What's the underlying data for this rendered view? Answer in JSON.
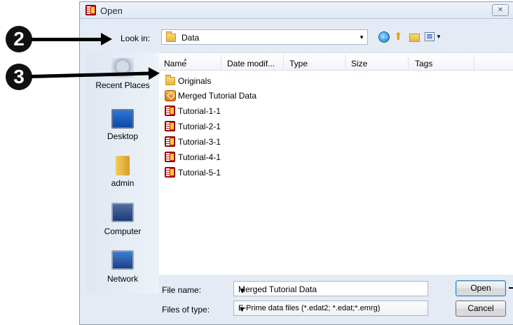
{
  "dialog": {
    "title": "Open",
    "close_label": "✕"
  },
  "toolbar": {
    "look_in_label": "Look in:",
    "look_in_value": "Data",
    "icons": [
      "back-icon",
      "up-folder-icon",
      "new-folder-icon",
      "views-icon",
      "views-menu-icon"
    ]
  },
  "places": [
    {
      "label": "Recent Places",
      "icon": "recent-places-icon"
    },
    {
      "label": "Desktop",
      "icon": "desktop-icon"
    },
    {
      "label": "admin",
      "icon": "user-folder-icon"
    },
    {
      "label": "Computer",
      "icon": "computer-icon"
    },
    {
      "label": "Network",
      "icon": "network-icon"
    }
  ],
  "columns": [
    "Name",
    "Date modif...",
    "Type",
    "Size",
    "Tags"
  ],
  "files": [
    {
      "name": "Originals",
      "icon": "folder-icon"
    },
    {
      "name": "Merged Tutorial Data",
      "icon": "merged-data-file-icon"
    },
    {
      "name": "Tutorial-1-1",
      "icon": "eprime-data-file-icon"
    },
    {
      "name": "Tutorial-2-1",
      "icon": "eprime-data-file-icon"
    },
    {
      "name": "Tutorial-3-1",
      "icon": "eprime-data-file-icon"
    },
    {
      "name": "Tutorial-4-1",
      "icon": "eprime-data-file-icon"
    },
    {
      "name": "Tutorial-5-1",
      "icon": "eprime-data-file-icon"
    }
  ],
  "footer": {
    "file_name_label": "File name:",
    "file_name_value": "Merged Tutorial Data",
    "file_type_label": "Files of type:",
    "file_type_value": "E-Prime data files (*.edat2; *.edat;*.emrg)",
    "open_label": "Open",
    "cancel_label": "Cancel"
  },
  "callouts": [
    {
      "number": "2"
    },
    {
      "number": "3"
    }
  ],
  "colors": {
    "dialog_bg": "#e4ebf4",
    "list_bg": "#ffffff",
    "callout": "#111111"
  }
}
